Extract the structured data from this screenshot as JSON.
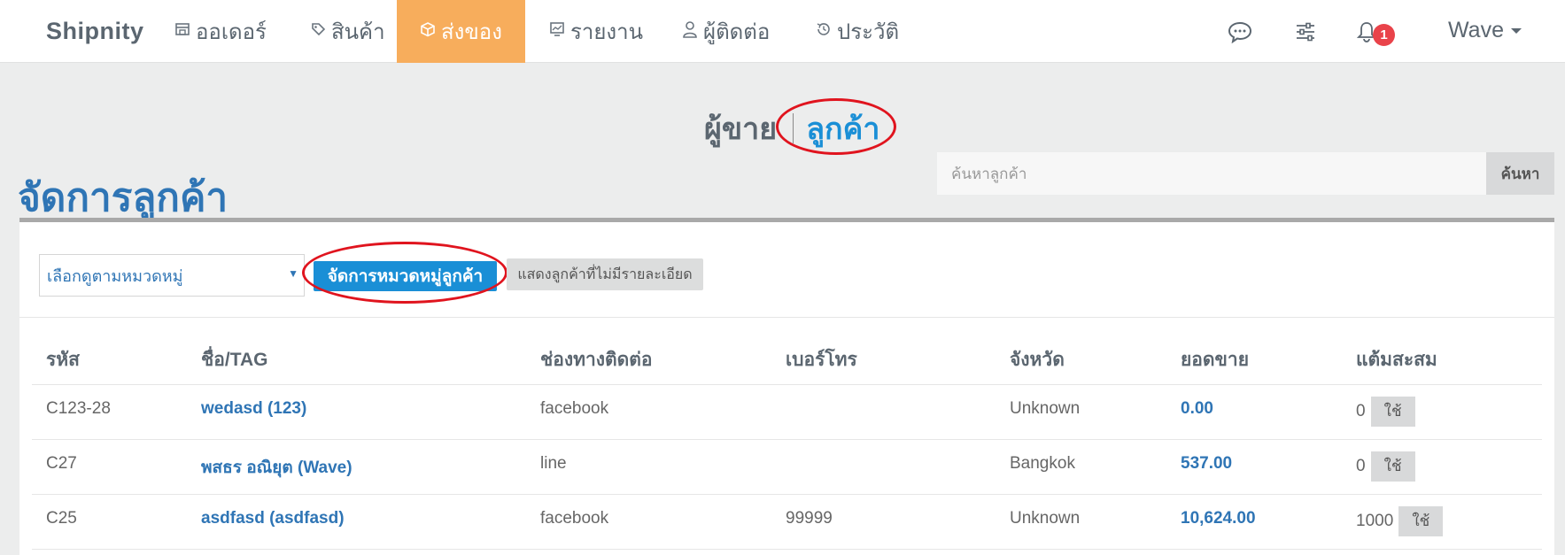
{
  "navbar": {
    "brand": "Shipnity",
    "items": [
      {
        "label": "ออเดอร์",
        "icon": "store-icon",
        "active": false
      },
      {
        "label": "สินค้า",
        "icon": "tag-icon",
        "active": false
      },
      {
        "label": "ส่งของ",
        "icon": "box-icon",
        "active": true
      },
      {
        "label": "รายงาน",
        "icon": "chart-icon",
        "active": false
      },
      {
        "label": "ผู้ติดต่อ",
        "icon": "user-icon",
        "active": false
      },
      {
        "label": "ประวัติ",
        "icon": "history-icon",
        "active": false
      }
    ],
    "notification_count": "1",
    "user_name": "Wave"
  },
  "switch": {
    "seller_label": "ผู้ขาย",
    "customer_label": "ลูกค้า"
  },
  "page_title": "จัดการลูกค้า",
  "search": {
    "placeholder": "ค้นหาลูกค้า",
    "button_label": "ค้นหา"
  },
  "toolbar": {
    "category_select": "เลือกดูตามหมวดหมู่",
    "manage_categories_label": "จัดการหมวดหมู่ลูกค้า",
    "show_no_detail_label": "แสดงลูกค้าที่ไม่มีรายละเอียด"
  },
  "table": {
    "headers": {
      "code": "รหัส",
      "name": "ชื่อ/TAG",
      "channel": "ช่องทางติดต่อ",
      "phone": "เบอร์โทร",
      "province": "จังหวัด",
      "sales": "ยอดขาย",
      "points": "แต้มสะสม"
    },
    "use_label": "ใช้",
    "rows": [
      {
        "code": "C123-28",
        "name": "wedasd (123)",
        "channel": "facebook",
        "phone": "",
        "province": "Unknown",
        "sales": "0.00",
        "points": "0"
      },
      {
        "code": "C27",
        "name": "พสธร อณิยุต (Wave)",
        "channel": "line",
        "phone": "",
        "province": "Bangkok",
        "sales": "537.00",
        "points": "0"
      },
      {
        "code": "C25",
        "name": "asdfasd (asdfasd)",
        "channel": "facebook",
        "phone": "99999",
        "province": "Unknown",
        "sales": "10,624.00",
        "points": "1000"
      }
    ]
  }
}
